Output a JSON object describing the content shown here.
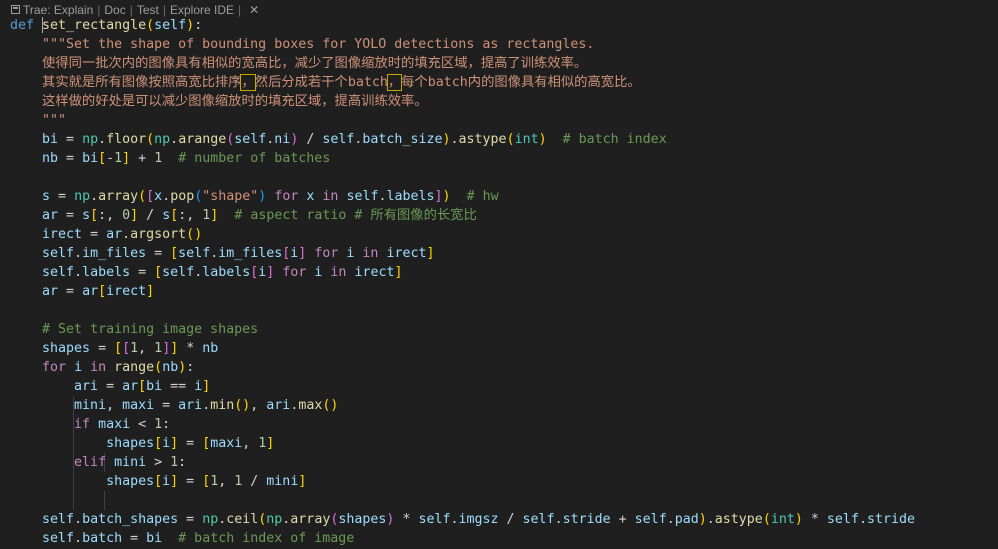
{
  "codelens": {
    "items": [
      "Trae: Explain",
      "Doc",
      "Test",
      "Explore IDE"
    ],
    "separator": "|",
    "close": "✕"
  },
  "code": {
    "def_kw": "def",
    "func_name": "set_rectangle",
    "param": "self",
    "doc1": "\"\"\"Set the shape of bounding boxes for YOLO detections as rectangles.",
    "doc2": "使得同一批次内的图像具有相似的宽高比，减少了图像缩放时的填充区域，提高了训练效率。",
    "doc3a": "其实就是所有图像按照高宽比排序",
    "doc3b": "，",
    "doc3c": "然后分成若干个batch",
    "doc3d": "，",
    "doc3e": "每个batch内的图像具有相似的高宽比。",
    "doc4": "这样做的好处是可以减少图像缩放时的填充区域，提高训练效率。",
    "doc5": "\"\"\"",
    "c_batch_index": "# batch index",
    "c_num_batches": "# number of batches",
    "c_hw": "# hw",
    "c_aspect": "# aspect ratio # 所有图像的长宽比",
    "c_set_shapes": "# Set training image shapes",
    "c_batch_index_img": "# batch index of image"
  }
}
